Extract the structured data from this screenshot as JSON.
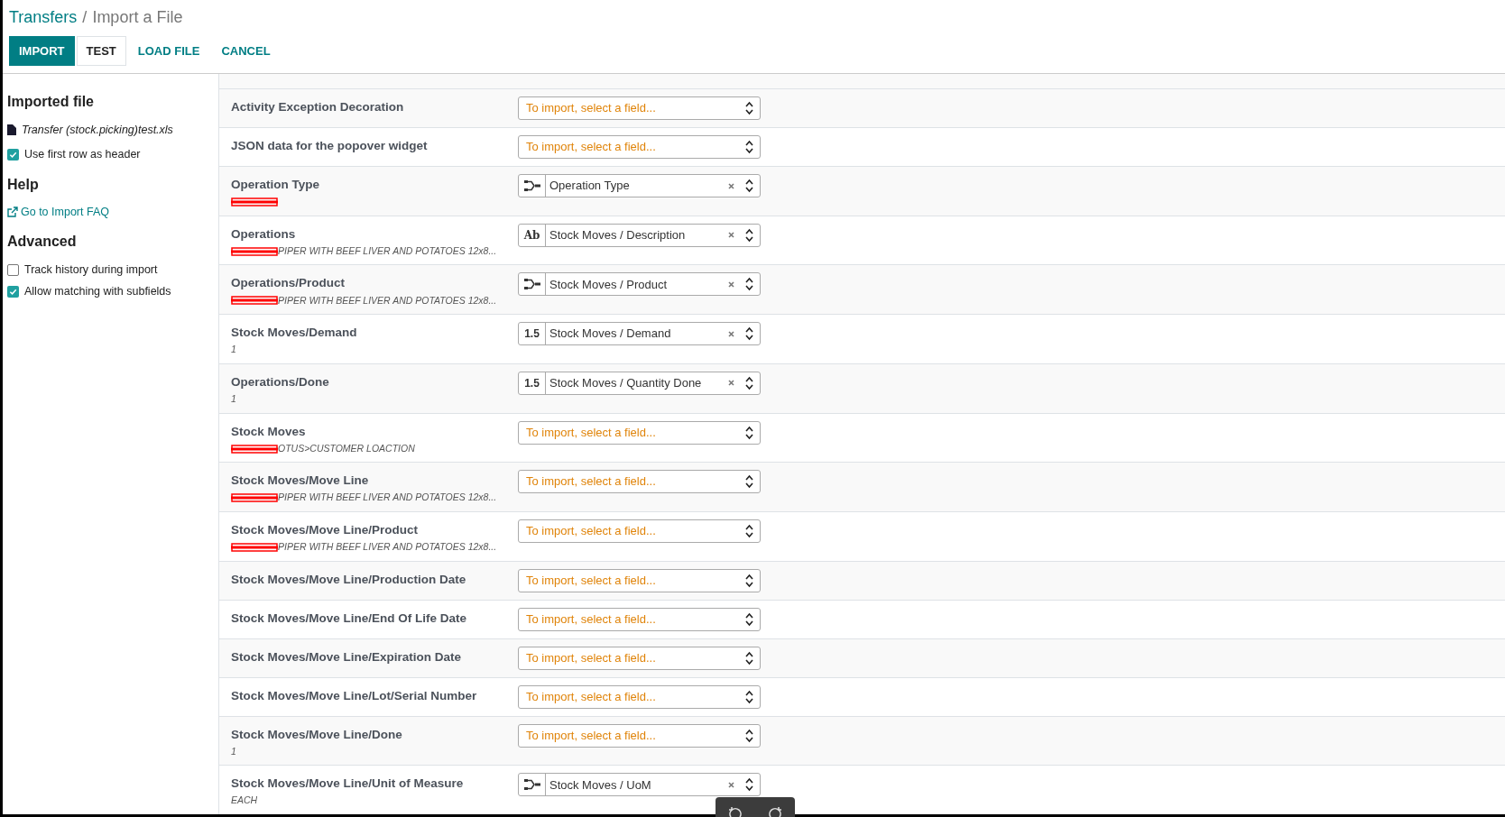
{
  "breadcrumb": {
    "parent": "Transfers",
    "current": "Import a File",
    "separator": "/"
  },
  "buttons": [
    {
      "label": "IMPORT",
      "kind": "primary"
    },
    {
      "label": "TEST",
      "kind": "secondary"
    },
    {
      "label": "LOAD FILE",
      "kind": "link"
    },
    {
      "label": "CANCEL",
      "kind": "link"
    }
  ],
  "sidebar": {
    "imported_heading": "Imported file",
    "file_name": "Transfer (stock.picking)test.xls",
    "options": [
      {
        "label": "Use first row as header",
        "checked": true
      }
    ],
    "help_heading": "Help",
    "help_link": "Go to Import FAQ",
    "advanced_heading": "Advanced",
    "advanced_options": [
      {
        "label": "Track history during import",
        "checked": false
      },
      {
        "label": "Allow matching with subfields",
        "checked": true
      }
    ]
  },
  "rows": [
    {
      "label": "Activity Exception Decoration",
      "select": {
        "placeholder": "To import, select a field..."
      }
    },
    {
      "label": "JSON data for the popover widget",
      "select": {
        "placeholder": "To import, select a field..."
      }
    },
    {
      "label": "Operation Type",
      "redacted": true,
      "select": {
        "kind": "relation",
        "value": "Operation Type"
      }
    },
    {
      "label": "Operations",
      "sample": "PIPER WITH BEEF LIVER AND POTATOES 12x8...",
      "redacted": true,
      "select": {
        "kind": "text",
        "type_label": "Ab",
        "value": "Stock Moves / Description"
      }
    },
    {
      "label": "Operations/Product",
      "sample": "PIPER WITH BEEF LIVER AND POTATOES 12x8...",
      "redacted": true,
      "select": {
        "kind": "relation",
        "value": "Stock Moves / Product"
      }
    },
    {
      "label": "Stock Moves/Demand",
      "sample": "1",
      "select": {
        "kind": "number",
        "type_label": "1.5",
        "value": "Stock Moves / Demand"
      }
    },
    {
      "label": "Operations/Done",
      "sample": "1",
      "select": {
        "kind": "number",
        "type_label": "1.5",
        "value": "Stock Moves / Quantity Done"
      }
    },
    {
      "label": "Stock Moves",
      "sample": "OTUS>CUSTOMER LOACTION",
      "redacted": true,
      "select": {
        "placeholder": "To import, select a field..."
      }
    },
    {
      "label": "Stock Moves/Move Line",
      "sample": "PIPER WITH BEEF LIVER AND POTATOES 12x8...",
      "redacted": true,
      "select": {
        "placeholder": "To import, select a field..."
      }
    },
    {
      "label": "Stock Moves/Move Line/Product",
      "sample": "PIPER WITH BEEF LIVER AND POTATOES 12x8...",
      "redacted": true,
      "select": {
        "placeholder": "To import, select a field..."
      }
    },
    {
      "label": "Stock Moves/Move Line/Production Date",
      "select": {
        "placeholder": "To import, select a field..."
      }
    },
    {
      "label": "Stock Moves/Move Line/End Of Life Date",
      "select": {
        "placeholder": "To import, select a field..."
      }
    },
    {
      "label": "Stock Moves/Move Line/Expiration Date",
      "select": {
        "placeholder": "To import, select a field..."
      }
    },
    {
      "label": "Stock Moves/Move Line/Lot/Serial Number",
      "select": {
        "placeholder": "To import, select a field..."
      }
    },
    {
      "label": "Stock Moves/Move Line/Done",
      "sample": "1",
      "select": {
        "placeholder": "To import, select a field..."
      }
    },
    {
      "label": "Stock Moves/Move Line/Unit of Measure",
      "sample": "EACH",
      "select": {
        "kind": "relation",
        "value": "Stock Moves / UoM"
      }
    }
  ]
}
